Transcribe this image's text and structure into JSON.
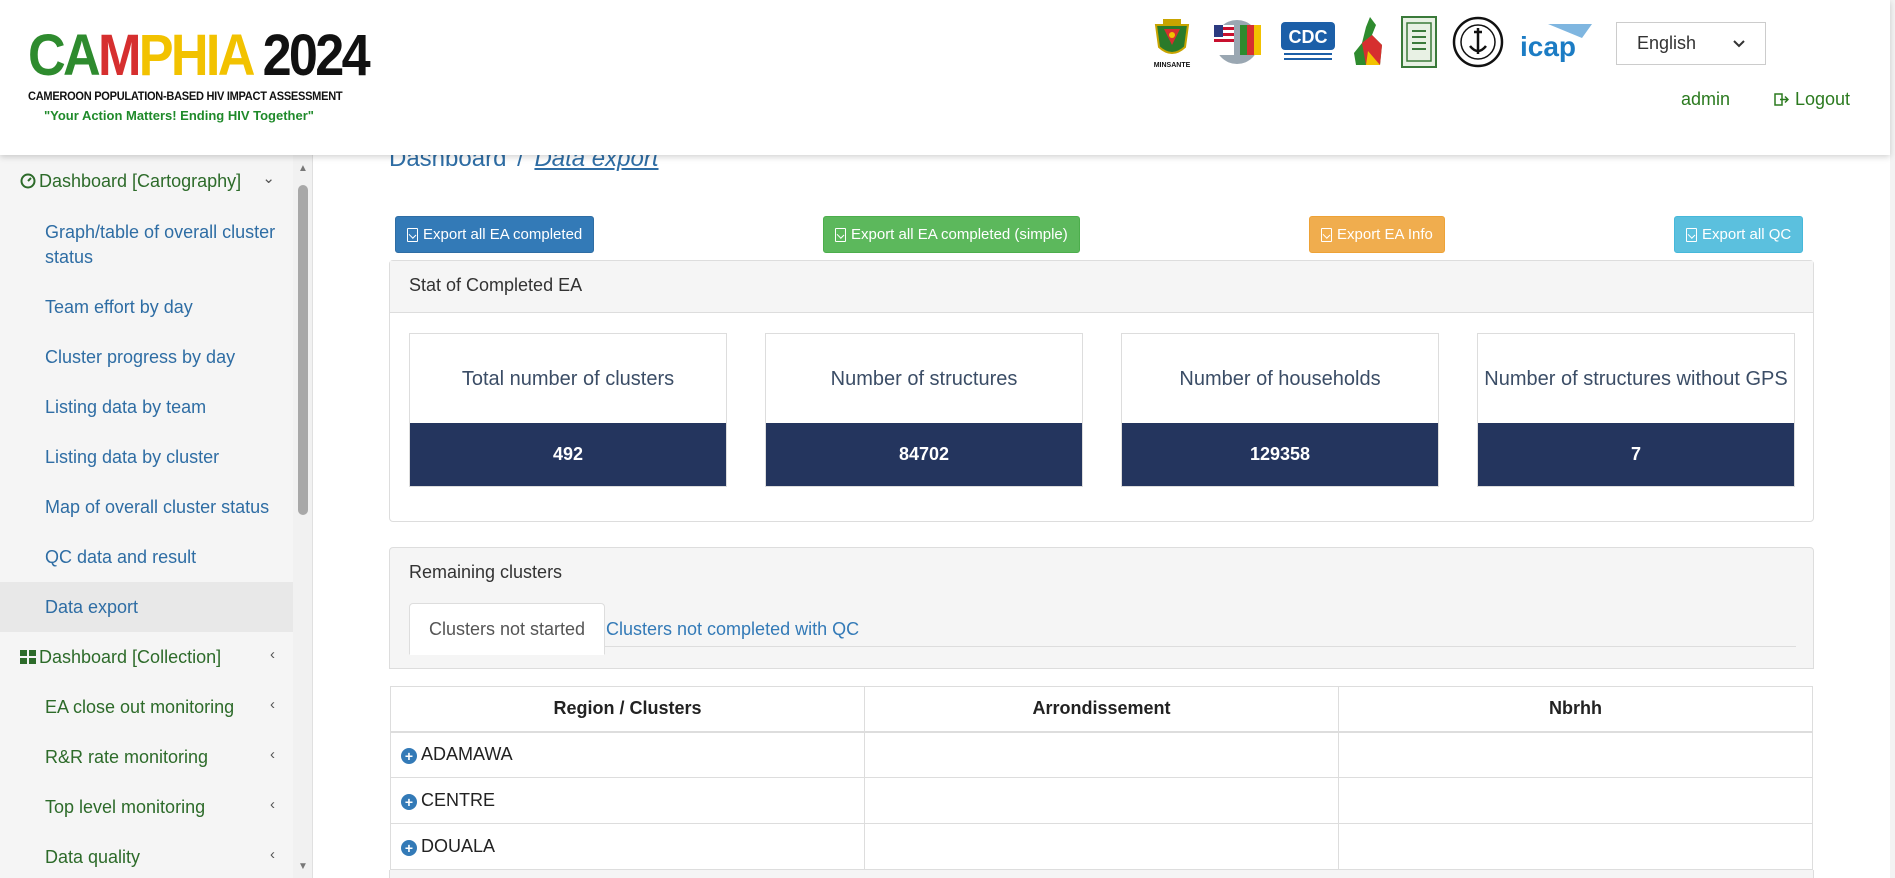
{
  "header": {
    "logo": {
      "title_parts": [
        "CA",
        "M",
        "PHIA",
        " 2024"
      ],
      "subtitle": "CAMEROON POPULATION-BASED HIV IMPACT ASSESSMENT",
      "tagline": "\"Your Action Matters! Ending HIV Together\""
    },
    "partners": [
      "MINSANTE",
      "CDC",
      "icap"
    ],
    "language": "English",
    "user": "admin",
    "logout_label": "Logout"
  },
  "sidebar": {
    "cartography_label": "Dashboard [Cartography]",
    "items": [
      {
        "label": "Graph/table of overall cluster status"
      },
      {
        "label": "Team effort by day"
      },
      {
        "label": "Cluster progress by day"
      },
      {
        "label": "Listing data by team"
      },
      {
        "label": "Listing data by cluster"
      },
      {
        "label": "Map of overall cluster status"
      },
      {
        "label": "QC data and result"
      },
      {
        "label": "Data export"
      }
    ],
    "collection_label": "Dashboard [Collection]",
    "subgroups": [
      {
        "label": "EA close out monitoring"
      },
      {
        "label": "R&R rate monitoring"
      },
      {
        "label": "Top level monitoring"
      },
      {
        "label": "Data quality"
      }
    ]
  },
  "main": {
    "breadcrumb": {
      "root": "Dashboard",
      "sep": "/",
      "current": "Data export"
    },
    "buttons": {
      "export_all": "Export all EA completed",
      "export_simple": "Export all EA completed (simple)",
      "export_info": "Export EA Info",
      "export_qc": "Export all QC"
    },
    "stats": {
      "title": "Stat of Completed EA",
      "boxes": [
        {
          "label": "Total number of clusters",
          "value": "492"
        },
        {
          "label": "Number of structures",
          "value": "84702"
        },
        {
          "label": "Number of households",
          "value": "129358"
        },
        {
          "label": "Number of structures without GPS",
          "value": "7"
        }
      ]
    },
    "remaining": {
      "title": "Remaining clusters",
      "tabs": [
        "Clusters not started",
        "Clusters not completed with QC"
      ],
      "columns": [
        "Region / Clusters",
        "Arrondissement",
        "Nbrhh"
      ],
      "rows": [
        {
          "region": "ADAMAWA"
        },
        {
          "region": "CENTRE"
        },
        {
          "region": "DOUALA"
        }
      ]
    }
  },
  "colors": {
    "stat_bar": "#24355e",
    "link_blue": "#337ab7",
    "green_text": "#2b7a1f"
  }
}
